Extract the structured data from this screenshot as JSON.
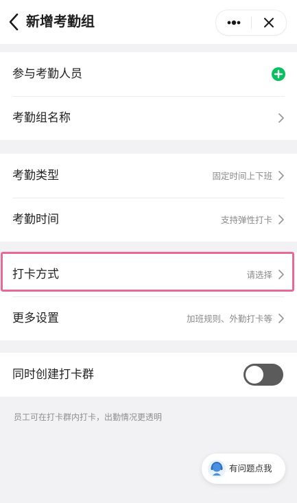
{
  "header": {
    "title": "新增考勤组",
    "back_icon": "chevron-left-icon",
    "more_icon": "ellipsis-icon",
    "close_icon": "close-icon"
  },
  "group1": {
    "members": {
      "label": "参与考勤人员",
      "icon": "plus-circle-icon",
      "icon_color": "#07c160"
    },
    "name": {
      "label": "考勤组名称"
    }
  },
  "group2": {
    "type": {
      "label": "考勤类型",
      "value": "固定时间上下班"
    },
    "time": {
      "label": "考勤时间",
      "value": "支持弹性打卡"
    }
  },
  "group3": {
    "method": {
      "label": "打卡方式",
      "value": "请选择"
    },
    "more": {
      "label": "更多设置",
      "value": "加班规则、外勤打卡等"
    }
  },
  "group4": {
    "create_group": {
      "label": "同时创建打卡群",
      "enabled": false
    },
    "hint": "员工可在打卡群内打卡，出勤情况更透明"
  },
  "help": {
    "label": "有问题点我"
  },
  "colors": {
    "highlight": "#e86a93",
    "accent": "#07c160",
    "toggle_off": "#5b5b5b"
  }
}
